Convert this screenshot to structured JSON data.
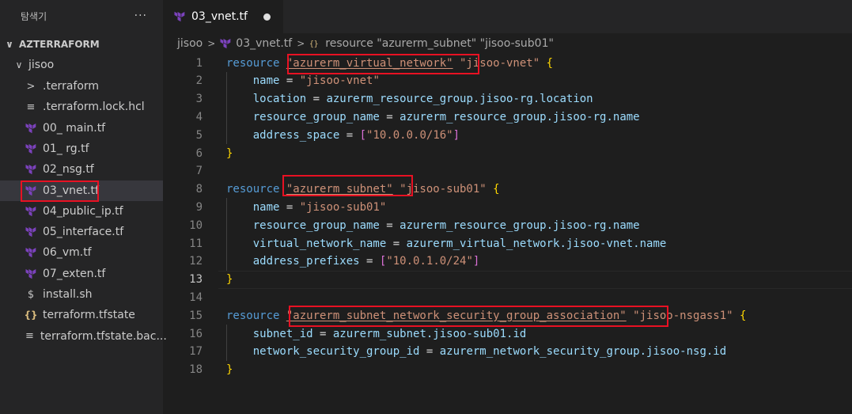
{
  "explorer": {
    "title": "탐색기",
    "more_label": "···",
    "root": {
      "label": "AZTERRAFORM",
      "chevron": "∨"
    },
    "folder": {
      "label": "jisoo",
      "chevron": "∨"
    },
    "items": [
      {
        "label": ".terraform",
        "icon": "chevron-right-icon",
        "glyph": ">"
      },
      {
        "label": ".terraform.lock.hcl",
        "icon": "lines-icon",
        "glyph": "≡"
      },
      {
        "label": "00_ main.tf",
        "icon": "terraform-icon"
      },
      {
        "label": "01_ rg.tf",
        "icon": "terraform-icon"
      },
      {
        "label": "02_nsg.tf",
        "icon": "terraform-icon"
      },
      {
        "label": "03_vnet.tf",
        "icon": "terraform-icon",
        "selected": true
      },
      {
        "label": "04_public_ip.tf",
        "icon": "terraform-icon"
      },
      {
        "label": "05_interface.tf",
        "icon": "terraform-icon"
      },
      {
        "label": "06_vm.tf",
        "icon": "terraform-icon"
      },
      {
        "label": "07_exten.tf",
        "icon": "terraform-icon"
      },
      {
        "label": "install.sh",
        "icon": "shell-icon",
        "glyph": "$"
      },
      {
        "label": "terraform.tfstate",
        "icon": "json-braces-icon",
        "glyph": "{}"
      },
      {
        "label": "terraform.tfstate.bac...",
        "icon": "lines-icon",
        "glyph": "≡"
      }
    ]
  },
  "tab": {
    "label": "03_vnet.tf",
    "modified": true
  },
  "breadcrumb": {
    "folder": "jisoo",
    "file": "03_vnet.tf",
    "symbol": "resource \"azurerm_subnet\" \"jisoo-sub01\"",
    "separator": ">"
  },
  "editor": {
    "current_line": 13,
    "lines": [
      {
        "n": "1",
        "t": [
          [
            "kw",
            "resource "
          ],
          [
            "str ul",
            "\"azurerm_virtual_network\""
          ],
          [
            "str",
            " \"jisoo-vnet\""
          ],
          [
            "op",
            " "
          ],
          [
            "bY",
            "{"
          ]
        ]
      },
      {
        "n": "2",
        "t": [
          [
            "op",
            "    "
          ],
          [
            "attr",
            "name"
          ],
          [
            "op",
            " = "
          ],
          [
            "str",
            "\"jisoo-vnet\""
          ]
        ]
      },
      {
        "n": "3",
        "t": [
          [
            "op",
            "    "
          ],
          [
            "attr",
            "location"
          ],
          [
            "op",
            " = "
          ],
          [
            "attr",
            "azurerm_resource_group.jisoo-rg.location"
          ]
        ]
      },
      {
        "n": "4",
        "t": [
          [
            "op",
            "    "
          ],
          [
            "attr",
            "resource_group_name"
          ],
          [
            "op",
            " = "
          ],
          [
            "attr",
            "azurerm_resource_group.jisoo-rg.name"
          ]
        ]
      },
      {
        "n": "5",
        "t": [
          [
            "op",
            "    "
          ],
          [
            "attr",
            "address_space"
          ],
          [
            "op",
            " = "
          ],
          [
            "bP",
            "["
          ],
          [
            "str",
            "\"10.0.0.0/16\""
          ],
          [
            "bP",
            "]"
          ]
        ]
      },
      {
        "n": "6",
        "t": [
          [
            "bY",
            "}"
          ]
        ]
      },
      {
        "n": "7",
        "t": []
      },
      {
        "n": "8",
        "t": [
          [
            "kw",
            "resource "
          ],
          [
            "str ul",
            "\"azurerm_subnet\""
          ],
          [
            "str",
            " \"jisoo-sub01\""
          ],
          [
            "op",
            " "
          ],
          [
            "bY",
            "{"
          ]
        ]
      },
      {
        "n": "9",
        "t": [
          [
            "op",
            "    "
          ],
          [
            "attr",
            "name"
          ],
          [
            "op",
            " = "
          ],
          [
            "str",
            "\"jisoo-sub01\""
          ]
        ]
      },
      {
        "n": "10",
        "t": [
          [
            "op",
            "    "
          ],
          [
            "attr",
            "resource_group_name"
          ],
          [
            "op",
            " = "
          ],
          [
            "attr",
            "azurerm_resource_group.jisoo-rg.name"
          ]
        ]
      },
      {
        "n": "11",
        "t": [
          [
            "op",
            "    "
          ],
          [
            "attr",
            "virtual_network_name"
          ],
          [
            "op",
            " = "
          ],
          [
            "attr",
            "azurerm_virtual_network.jisoo-vnet.name"
          ]
        ]
      },
      {
        "n": "12",
        "t": [
          [
            "op",
            "    "
          ],
          [
            "attr",
            "address_prefixes"
          ],
          [
            "op",
            " = "
          ],
          [
            "bP",
            "["
          ],
          [
            "str",
            "\"10.0.1.0/24\""
          ],
          [
            "bP",
            "]"
          ]
        ]
      },
      {
        "n": "13",
        "t": [
          [
            "bY",
            "}"
          ]
        ]
      },
      {
        "n": "14",
        "t": []
      },
      {
        "n": "15",
        "t": [
          [
            "kw",
            "resource "
          ],
          [
            "str ul",
            "\"azurerm_subnet_network_security_group_association\""
          ],
          [
            "str",
            " \"jisoo-nsgass1\""
          ],
          [
            "op",
            " "
          ],
          [
            "bY",
            "{"
          ]
        ]
      },
      {
        "n": "16",
        "t": [
          [
            "op",
            "    "
          ],
          [
            "attr",
            "subnet_id"
          ],
          [
            "op",
            " = "
          ],
          [
            "attr",
            "azurerm_subnet.jisoo-sub01.id"
          ]
        ]
      },
      {
        "n": "17",
        "t": [
          [
            "op",
            "    "
          ],
          [
            "attr",
            "network_security_group_id"
          ],
          [
            "op",
            " = "
          ],
          [
            "attr",
            "azurerm_network_security_group.jisoo-nsg.id"
          ]
        ]
      },
      {
        "n": "18",
        "t": [
          [
            "bY",
            "}"
          ]
        ]
      }
    ]
  },
  "colors": {
    "terraform_icon": "#7b42bc",
    "highlight_box": "#e81123"
  }
}
